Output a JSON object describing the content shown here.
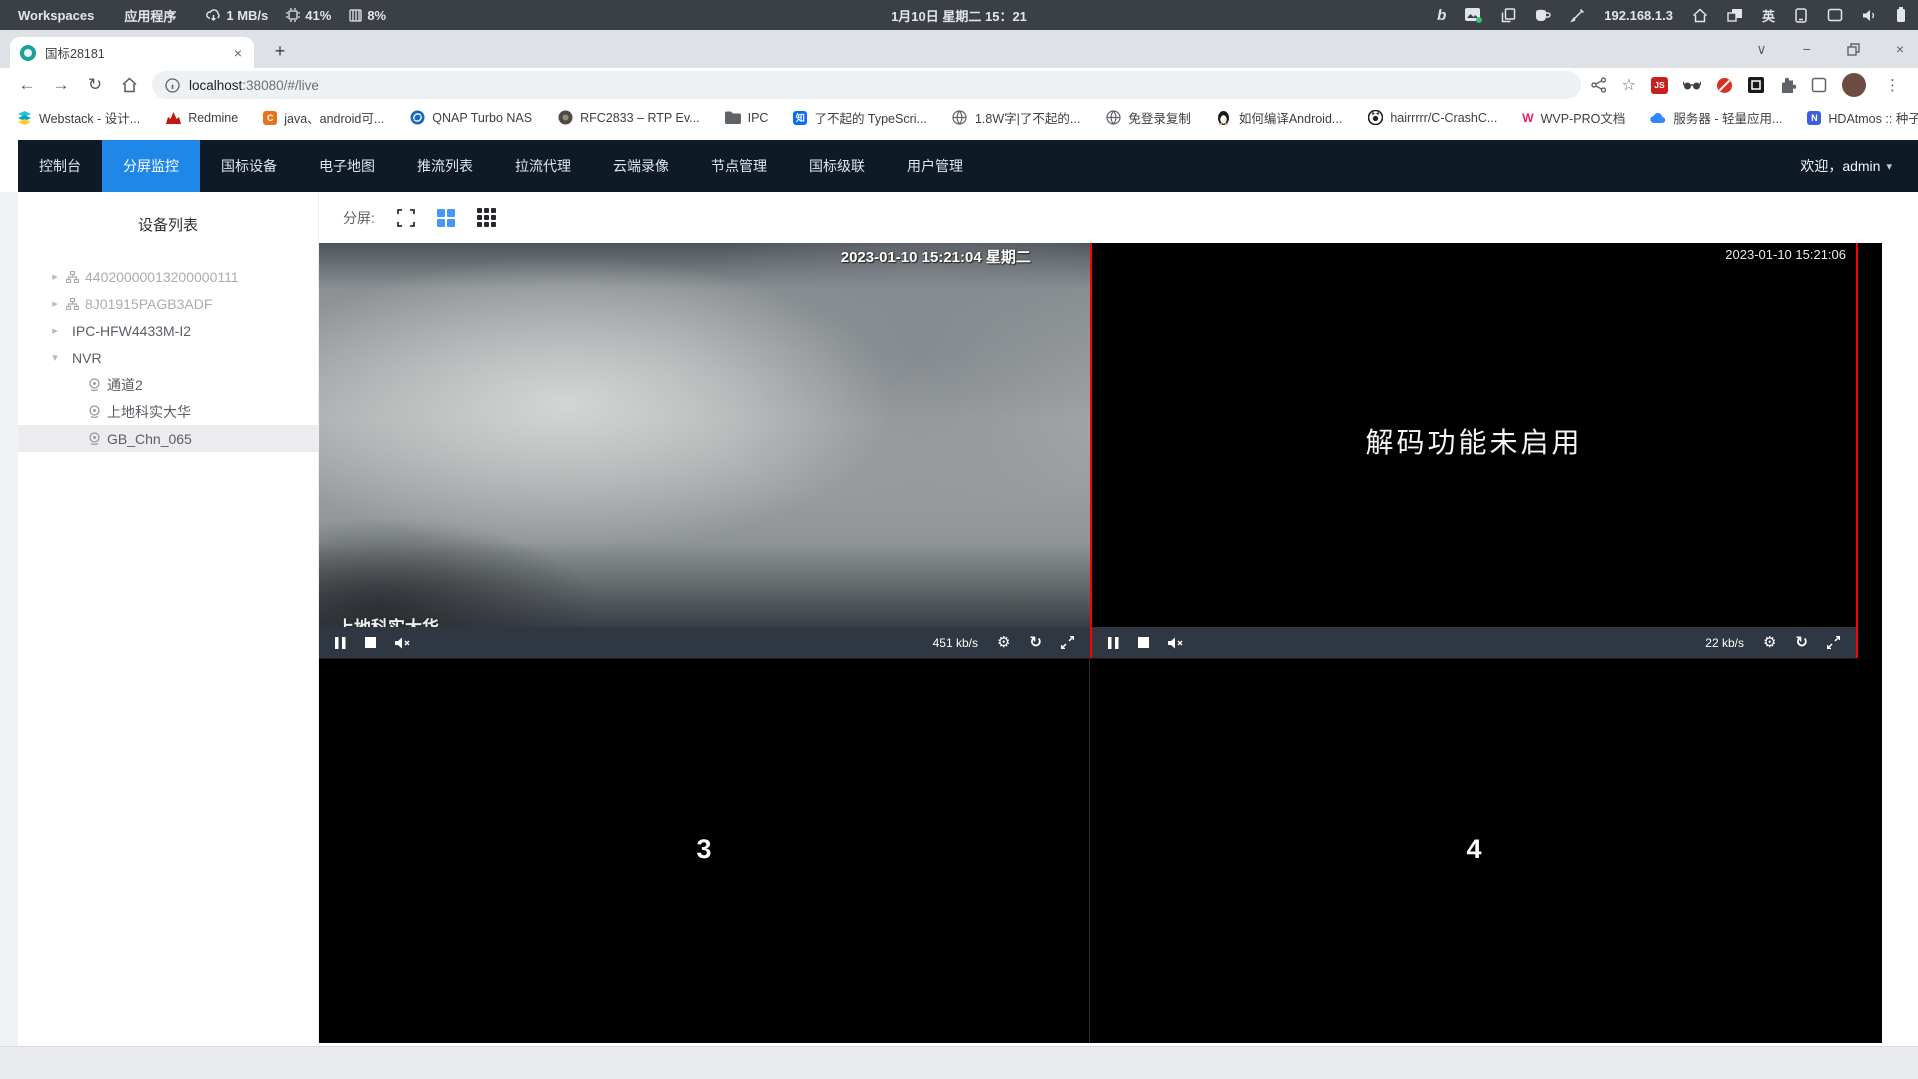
{
  "colors": {
    "nav_bg": "#0e1a26",
    "active_tab_blue": "#1f87e8",
    "selected_cell_red": "#ff0000",
    "control_bar": "#2f3842"
  },
  "system_bar": {
    "workspaces": "Workspaces",
    "applications": "应用程序",
    "net_speed": "1 MB/s",
    "cpu": "41%",
    "mem": "8%",
    "clock": "1月10日 星期二 15：21",
    "ip": "192.168.1.3",
    "ime": "英",
    "bing": "b"
  },
  "browser": {
    "tab_title": "国标28181",
    "new_tab": "+",
    "url_host": "localhost",
    "url_rest": ":38080/#/live",
    "js_badge": "JS",
    "bookmarks_overflow": "»",
    "bookmarks": [
      {
        "label": "Webstack - 设计..."
      },
      {
        "label": "Redmine"
      },
      {
        "label": "java、android可...",
        "icon_text": "C"
      },
      {
        "label": "QNAP Turbo NAS"
      },
      {
        "label": "RFC2833 – RTP Ev..."
      },
      {
        "label": "IPC"
      },
      {
        "label": "了不起的 TypeScri...",
        "icon_text": "知"
      },
      {
        "label": "1.8W字|了不起的..."
      },
      {
        "label": "免登录复制"
      },
      {
        "label": "如何编译Android..."
      },
      {
        "label": "hairrrrr/C-CrashC..."
      },
      {
        "label": "WVP-PRO文档",
        "icon_text": "W"
      },
      {
        "label": "服务器 - 轻量应用..."
      },
      {
        "label": "HDAtmos :: 种子 *...",
        "icon_text": "N"
      }
    ]
  },
  "nav": {
    "tabs": [
      "控制台",
      "分屏监控",
      "国标设备",
      "电子地图",
      "推流列表",
      "拉流代理",
      "云端录像",
      "节点管理",
      "国标级联",
      "用户管理"
    ],
    "active": "分屏监控",
    "welcome": "欢迎，admin"
  },
  "sidebar": {
    "title": "设备列表",
    "tree": [
      {
        "label": "44020000013200000111"
      },
      {
        "label": "8J01915PAGB3ADF"
      },
      {
        "label": "IPC-HFW4433M-I2"
      },
      {
        "label": "NVR"
      },
      {
        "label": "通道2"
      },
      {
        "label": "上地科实大华"
      },
      {
        "label": "GB_Chn_065"
      }
    ]
  },
  "toolbar": {
    "split_label": "分屏:"
  },
  "videos": {
    "v1": {
      "timestamp": "2023-01-10 15:21:04 星期二",
      "name": "上地科实大华",
      "bitrate": "451 kb/s"
    },
    "v2": {
      "timestamp": "2023-01-10 15:21:06",
      "message": "解码功能未启用",
      "bitrate": "22 kb/s"
    },
    "v3": {
      "number": "3"
    },
    "v4": {
      "number": "4"
    }
  }
}
